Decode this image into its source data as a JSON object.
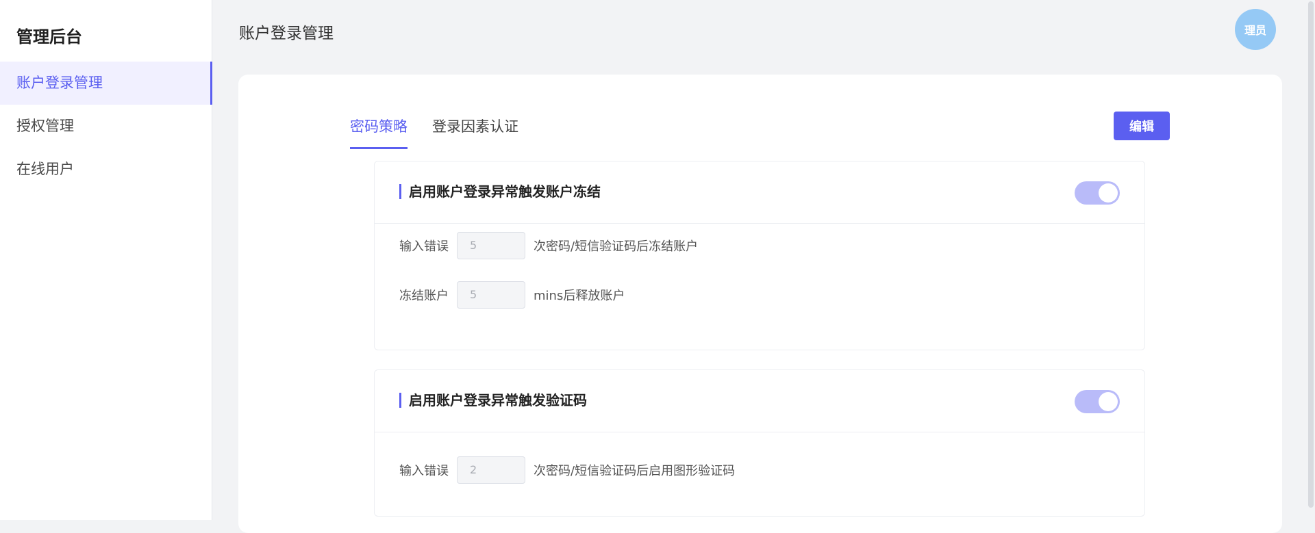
{
  "sidebar": {
    "brand": "管理后台",
    "items": [
      {
        "label": "账户登录管理",
        "active": true
      },
      {
        "label": "授权管理"
      },
      {
        "label": "在线用户"
      }
    ]
  },
  "header": {
    "title": "账户登录管理",
    "avatar_text": "理员"
  },
  "tabs": [
    {
      "label": "密码策略",
      "active": true
    },
    {
      "label": "登录因素认证"
    }
  ],
  "edit_button": "编辑",
  "sections": [
    {
      "title": "启用账户登录异常触发账户冻结",
      "enabled": true,
      "rows": [
        {
          "prefix": "输入错误",
          "value": "5",
          "suffix": "次密码/短信验证码后冻结账户"
        },
        {
          "prefix": "冻结账户",
          "value": "5",
          "suffix": "mins后释放账户"
        }
      ]
    },
    {
      "title": "启用账户登录异常触发验证码",
      "enabled": true,
      "rows": [
        {
          "prefix": "输入错误",
          "value": "2",
          "suffix": "次密码/短信验证码后启用图形验证码"
        }
      ]
    }
  ],
  "colors": {
    "accent": "#5b5ff0",
    "toggle_on": "#b9bbf9",
    "avatar": "#95c9f5",
    "background": "#f2f3f5"
  }
}
